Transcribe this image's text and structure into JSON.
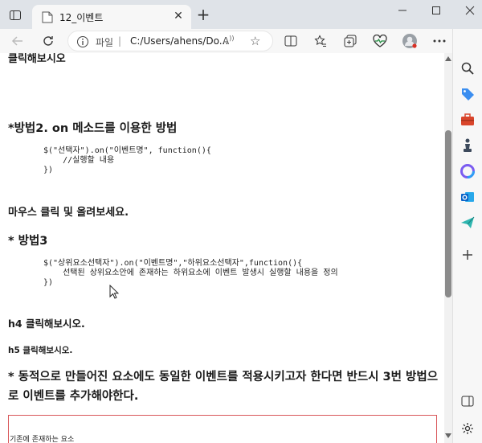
{
  "browser": {
    "tab_title": "12_이벤트",
    "address_scheme": "파일",
    "address_separator": "|",
    "address_url": "C:/Users/ahens/Do...",
    "reader_mode_label": "A",
    "new_tab_label": "+",
    "tab_close_label": "✕"
  },
  "page": {
    "cut_heading": "클릭해보시오",
    "section2_title": "*방법2. on 메소드를 이용한 방법",
    "code2": "$(\"선택자\").on(\"이벤트명\", function(){\n    //실행할 내용\n})",
    "mouse_text": "마우스 클릭 및 올려보세요.",
    "section3_title": "* 방법3",
    "code3": "$(\"상위요소선택자\").on(\"이벤트명\",\"하위요소선택자\",function(){\n    선택된 상위요소안에 존재하는 하위요소에 이벤트 발생시 실행할 내용을 정의\n})",
    "h4_text": "h4 클릭해보시오.",
    "h5_text": "h5 클릭해보시오.",
    "dynamic_note": "* 동적으로 만들어진 요소에도 동일한 이벤트를 적용시키고자 한다면 반드시 3번 방법으로 이벤트를 추가해야한다.",
    "existing_element_label": "기존에 존재하는 요소"
  },
  "colors": {
    "tab_strip": "#dfe3e8",
    "toolbar": "#f7f7f7",
    "red_border": "#d9575a"
  }
}
